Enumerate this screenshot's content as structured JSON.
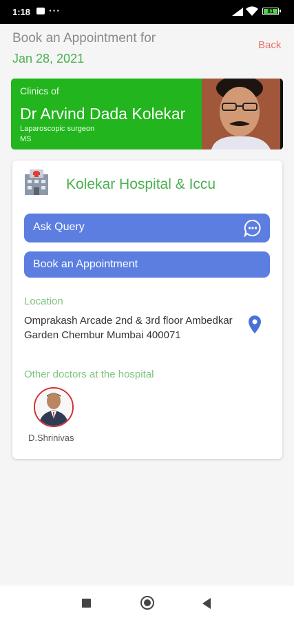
{
  "status_bar": {
    "time": "1:18",
    "dots": "···",
    "battery": "81"
  },
  "header": {
    "title": "Book an Appointment for",
    "date": "Jan 28, 2021",
    "back_label": "Back"
  },
  "doctor_banner": {
    "subtitle": "Clinics of",
    "name": "Dr Arvind Dada Kolekar",
    "specialty": "Laparoscopic surgeon",
    "degree": "MS"
  },
  "clinic": {
    "name": "Kolekar Hospital & Iccu",
    "ask_query_label": "Ask Query",
    "book_label": "Book an Appointment",
    "location_label": "Location",
    "address": "Omprakash Arcade 2nd & 3rd floor Ambedkar Garden Chembur Mumbai 400071",
    "other_doctors_label": "Other doctors at the hospital",
    "other_doctors": [
      {
        "name": "D.Shrinivas"
      }
    ]
  },
  "colors": {
    "accent_green": "#22b51d",
    "text_green": "#4caf50",
    "button_blue": "#5b7ee0",
    "back_red": "#e57368"
  },
  "icons": [
    "hospital-icon",
    "chat-icon",
    "location-pin-icon",
    "doctor-avatar"
  ]
}
